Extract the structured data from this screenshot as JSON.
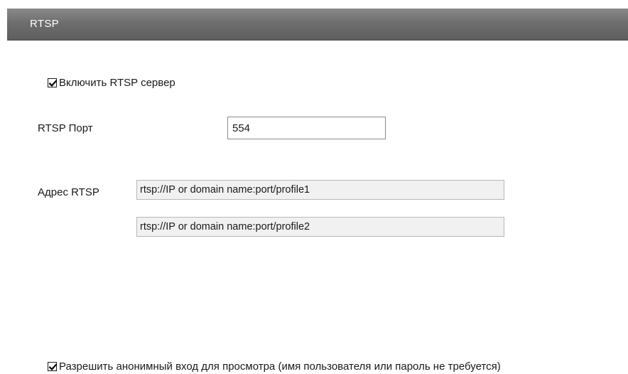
{
  "panel": {
    "title": "RTSP"
  },
  "enable_rtsp": {
    "label": "Включить RTSP сервер",
    "checked": true
  },
  "rtsp_port": {
    "label": "RTSP Порт",
    "value": "554"
  },
  "rtsp_address": {
    "label": "Адрес RTSP",
    "profile1": "rtsp://IP or domain name:port/profile1",
    "profile2": "rtsp://IP or domain name:port/profile2"
  },
  "anonymous_login": {
    "label": "Разрешить анонимный вход для просмотра (имя пользователя или пароль не требуется)",
    "checked": true
  },
  "icons": {
    "checkmark": "checkmark-icon"
  }
}
